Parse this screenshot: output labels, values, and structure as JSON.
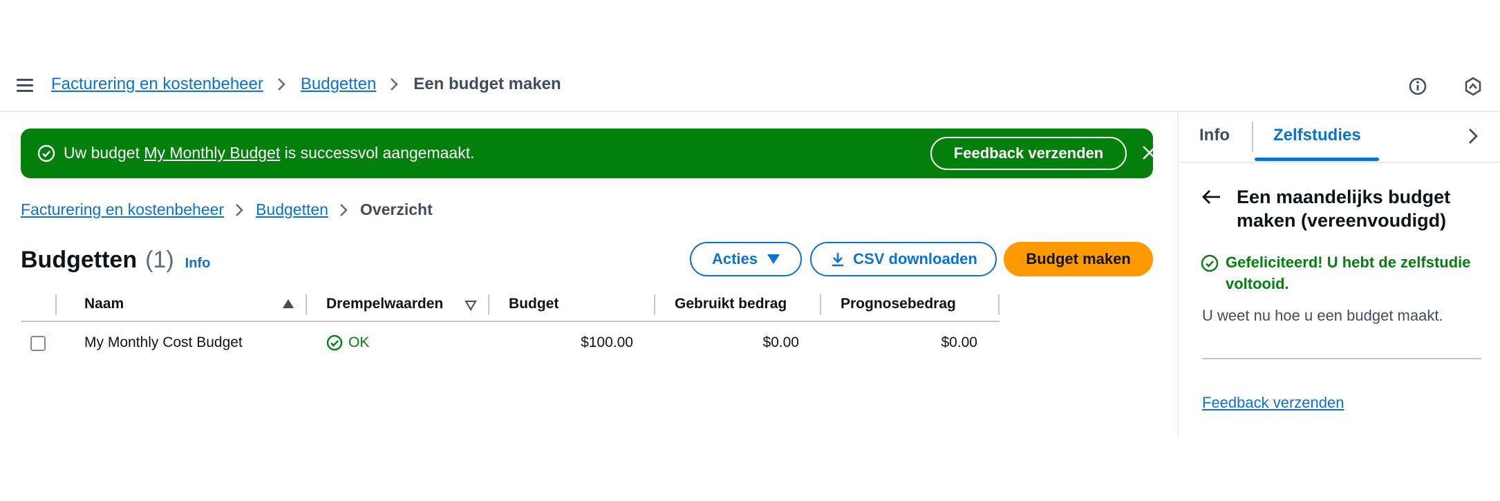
{
  "header": {
    "breadcrumbs": [
      "Facturering en kostenbeheer",
      "Budgetten"
    ],
    "current": "Een budget maken",
    "icons": [
      "info-icon",
      "settings-hex-icon"
    ]
  },
  "flash": {
    "prefix": "Uw budget ",
    "budget_link": "My Monthly Budget",
    "suffix": " is successvol aangemaakt.",
    "feedback_button": "Feedback verzenden",
    "color": "#037f0c"
  },
  "content_breadcrumbs": {
    "items": [
      "Facturering en kostenbeheer",
      "Budgetten"
    ],
    "current": "Overzicht"
  },
  "page": {
    "title": "Budgetten",
    "count": "(1)",
    "info": "Info"
  },
  "actions": {
    "acties": "Acties",
    "csv": "CSV downloaden",
    "create": "Budget maken",
    "primary_color": "#ff9900"
  },
  "table": {
    "columns": [
      "Naam",
      "Drempelwaarden",
      "Budget",
      "Gebruikt bedrag",
      "Prognosebedrag"
    ],
    "rows": [
      {
        "name": "My Monthly Cost Budget",
        "threshold": "OK",
        "budget": "$100.00",
        "used": "$0.00",
        "forecast": "$0.00"
      }
    ]
  },
  "side_panel": {
    "tabs": [
      "Info",
      "Zelfstudies"
    ],
    "active_tab": "Zelfstudies",
    "title": "Een maandelijks budget maken (vereenvoudigd)",
    "congrats": "Gefeliciteerd! U hebt de zelfstudie voltooid.",
    "body": "U weet nu hoe u een budget maakt.",
    "feedback": "Feedback verzenden"
  }
}
